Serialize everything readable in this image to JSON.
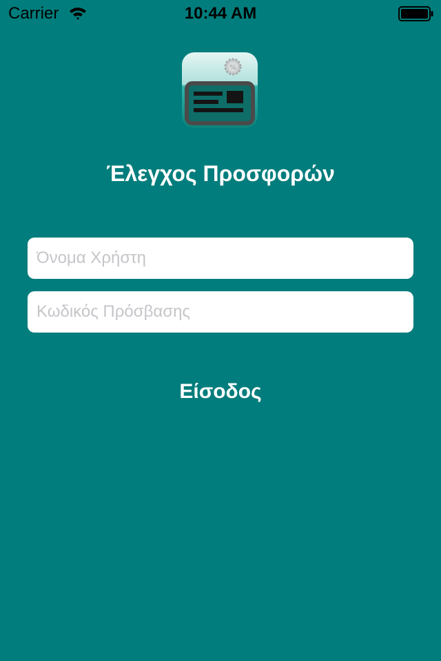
{
  "status_bar": {
    "carrier": "Carrier",
    "time": "10:44 AM",
    "icons": [
      "wifi-icon",
      "battery-icon"
    ]
  },
  "app": {
    "title": "Έλεγχος Προσφορών",
    "logo_icon": "offers-card-icon"
  },
  "login_form": {
    "username_placeholder": "Όνομα Χρήστη",
    "username_value": "",
    "password_placeholder": "Κωδικός Πρόσβασης",
    "password_value": "",
    "submit_label": "Είσοδος"
  },
  "colors": {
    "background": "#007d7c",
    "text": "#ffffff",
    "field_background": "#ffffff",
    "placeholder": "#c5c5ca"
  }
}
